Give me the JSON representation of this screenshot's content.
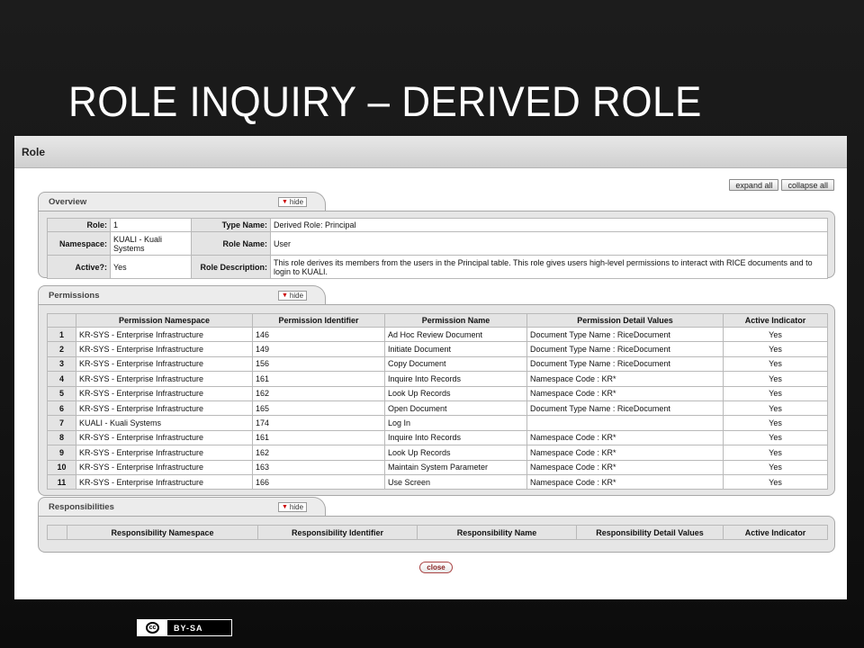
{
  "slide": {
    "title": "Role Inquiry – Derived Role"
  },
  "role_bar": {
    "label": "Role"
  },
  "controls": {
    "expand_all": "expand all",
    "collapse_all": "collapse all",
    "close": "close"
  },
  "overview": {
    "tab": "Overview",
    "hide": "hide",
    "role_label": "Role:",
    "role_value": "1",
    "type_label": "Type Name:",
    "type_value": "Derived Role: Principal",
    "namespace_label": "Namespace:",
    "namespace_value": "KUALI - Kuali Systems",
    "rolename_label": "Role Name:",
    "rolename_value": "User",
    "active_label": "Active?:",
    "active_value": "Yes",
    "desc_label": "Role Description:",
    "desc_value": "This role derives its members from the users in the Principal table. This role gives users high-level permissions to interact with RICE documents and to login to KUALI."
  },
  "permissions": {
    "tab": "Permissions",
    "hide": "hide",
    "columns": [
      "",
      "Permission Namespace",
      "Permission Identifier",
      "Permission Name",
      "Permission Detail Values",
      "Active Indicator"
    ],
    "rows": [
      [
        "1",
        "KR-SYS - Enterprise Infrastructure",
        "146",
        "Ad Hoc Review Document",
        "Document Type Name : RiceDocument",
        "Yes"
      ],
      [
        "2",
        "KR-SYS - Enterprise Infrastructure",
        "149",
        "Initiate Document",
        "Document Type Name : RiceDocument",
        "Yes"
      ],
      [
        "3",
        "KR-SYS - Enterprise Infrastructure",
        "156",
        "Copy Document",
        "Document Type Name : RiceDocument",
        "Yes"
      ],
      [
        "4",
        "KR-SYS - Enterprise Infrastructure",
        "161",
        "Inquire Into Records",
        "Namespace Code : KR*",
        "Yes"
      ],
      [
        "5",
        "KR-SYS - Enterprise Infrastructure",
        "162",
        "Look Up Records",
        "Namespace Code : KR*",
        "Yes"
      ],
      [
        "6",
        "KR-SYS - Enterprise Infrastructure",
        "165",
        "Open Document",
        "Document Type Name : RiceDocument",
        "Yes"
      ],
      [
        "7",
        "KUALI - Kuali Systems",
        "174",
        "Log In",
        "",
        "Yes"
      ],
      [
        "8",
        "KR-SYS - Enterprise Infrastructure",
        "161",
        "Inquire Into Records",
        "Namespace Code : KR*",
        "Yes"
      ],
      [
        "9",
        "KR-SYS - Enterprise Infrastructure",
        "162",
        "Look Up Records",
        "Namespace Code : KR*",
        "Yes"
      ],
      [
        "10",
        "KR-SYS - Enterprise Infrastructure",
        "163",
        "Maintain System Parameter",
        "Namespace Code : KR*",
        "Yes"
      ],
      [
        "11",
        "KR-SYS - Enterprise Infrastructure",
        "166",
        "Use Screen",
        "Namespace Code : KR*",
        "Yes"
      ]
    ]
  },
  "responsibilities": {
    "tab": "Responsibilities",
    "hide": "hide",
    "columns": [
      "",
      "Responsibility Namespace",
      "Responsibility Identifier",
      "Responsibility Name",
      "Responsibility Detail Values",
      "Active Indicator"
    ]
  },
  "license": {
    "cc": "cc",
    "text": "BY-SA"
  }
}
